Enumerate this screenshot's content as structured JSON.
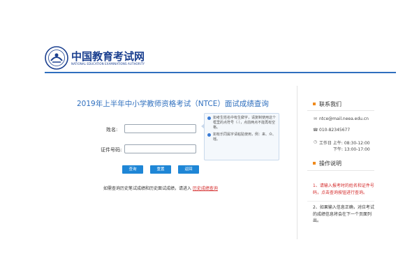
{
  "header": {
    "logo_cn": "中国教育考试网",
    "logo_en": "NATIONAL EDUCATION EXAMINATIONS AUTHORITY"
  },
  "main": {
    "title": "2019年上半年中小学教师资格考试（NTCE）面试成绩查询",
    "form": {
      "name_label": "姓名:",
      "name_value": "",
      "id_label": "证件号码:",
      "id_value": ""
    },
    "tips": [
      "如考生姓名中有生僻字，请复制使用这个框里的点符号（·），点前两点不能再有空格。",
      "如有乐同属字请粘贴使用，例：来、众、瑶。"
    ],
    "buttons": {
      "query": "查询",
      "clear": "重置",
      "back": "返回"
    },
    "history_text": "如需查询历史笔试成绩和历史面试成绩，请进入 ",
    "history_link": "历史成绩查询"
  },
  "sidebar": {
    "contact_title": "联系我们",
    "email": "ntce@mail.neea.edu.cn",
    "phone": "010-82345677",
    "hours_am_label": "工作日 上午:",
    "hours_am": "08:30-12:00",
    "hours_pm_label": "下午:",
    "hours_pm": "13:00-17:00",
    "ops_title": "操作说明",
    "ops_1": "1、请输入报考时的姓名和证件号码，点击查询按钮进行查询。",
    "ops_2": "2、如果输入信息正确，对应考试的成绩信息将会在下一个页面列出。"
  },
  "colors": {
    "brand": "#2f6fbe",
    "button": "#1e86d6",
    "accent_orange": "#f08a1c",
    "alert_red": "#d42b2b"
  }
}
